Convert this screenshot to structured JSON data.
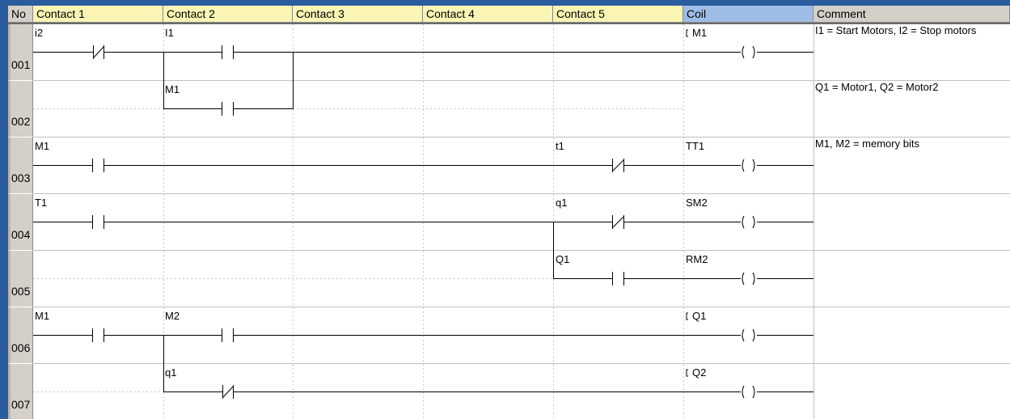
{
  "header": {
    "no": "No",
    "contact1": "Contact 1",
    "contact2": "Contact 2",
    "contact3": "Contact 3",
    "contact4": "Contact 4",
    "contact5": "Contact 5",
    "coil": "Coil",
    "comment": "Comment"
  },
  "rows": [
    "001",
    "002",
    "003",
    "004",
    "005",
    "006",
    "007"
  ],
  "labels": {
    "r1_c1": "i2",
    "r1_c2": "I1",
    "r1_coil": "M1",
    "r2_c2": "M1",
    "r3_c1": "M1",
    "r3_c5": "t1",
    "r3_coil": "TT1",
    "r4_c1": "T1",
    "r4_c5": "q1",
    "r4_coil": "SM2",
    "r5_c5": "Q1",
    "r5_coil": "RM2",
    "r6_c1": "M1",
    "r6_c2": "M2",
    "r6_coil": "Q1",
    "r7_c2": "q1",
    "r7_coil": "Q2"
  },
  "comments": {
    "r1": "I1 = Start Motors, I2 = Stop motors",
    "r2": "Q1 = Motor1, Q2 = Motor2",
    "r3": "M1, M2 = memory bits"
  },
  "colors": {
    "frame": "#2a5c9e",
    "header_contact": "#fbf5b5",
    "header_coil": "#9ebde6",
    "header_gray": "#d4d0c8"
  }
}
